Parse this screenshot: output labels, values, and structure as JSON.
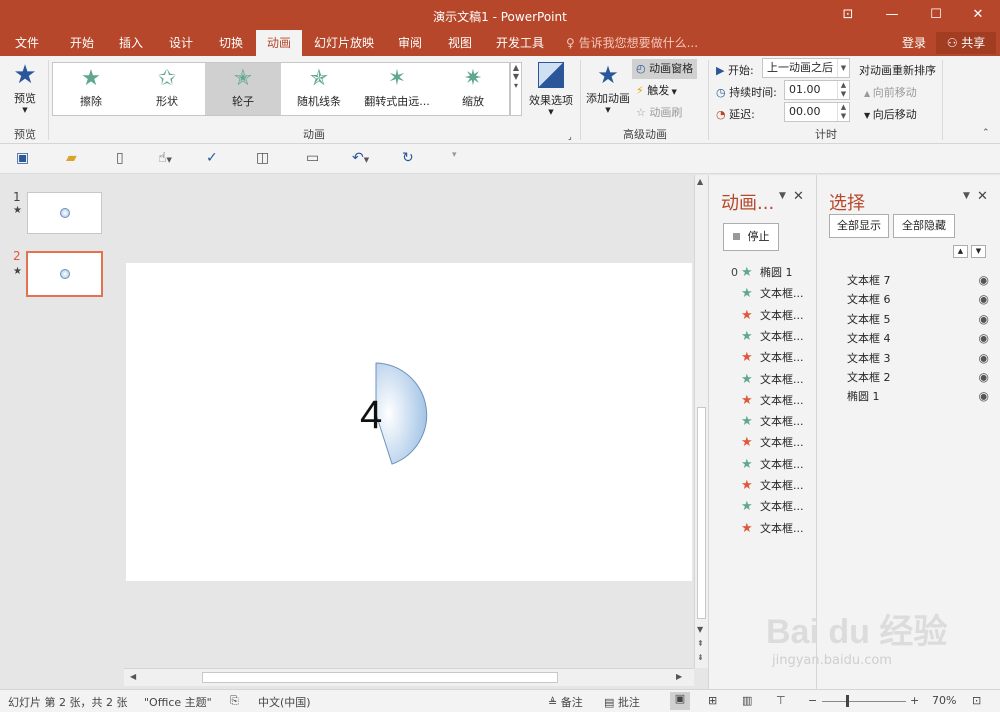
{
  "window": {
    "title": "演示文稿1 - PowerPoint"
  },
  "tabs": [
    "文件",
    "开始",
    "插入",
    "设计",
    "切换",
    "动画",
    "幻灯片放映",
    "审阅",
    "视图",
    "开发工具"
  ],
  "active_tab": "动画",
  "tell_me": "告诉我您想要做什么...",
  "signin": "登录",
  "share": "共享",
  "ribbon": {
    "preview": {
      "label": "预览",
      "group": "预览"
    },
    "animations": {
      "items": [
        {
          "label": "擦除",
          "color": "#5fa88e"
        },
        {
          "label": "形状",
          "color": "#5fa88e"
        },
        {
          "label": "轮子",
          "color": "#5fa88e"
        },
        {
          "label": "随机线条",
          "color": "#5fa88e"
        },
        {
          "label": "翻转式由远...",
          "color": "#5fa88e"
        },
        {
          "label": "缩放",
          "color": "#5fa88e"
        }
      ],
      "selected_index": 2,
      "effect_options": "效果选项",
      "group": "动画"
    },
    "advanced": {
      "add_animation": "添加动画",
      "animation_pane": "动画窗格",
      "trigger": "触发",
      "painter": "动画刷",
      "group": "高级动画"
    },
    "timing": {
      "start_label": "开始:",
      "start_value": "上一动画之后",
      "duration_label": "持续时间:",
      "duration_value": "01.00",
      "delay_label": "延迟:",
      "delay_value": "00.00",
      "reorder_title": "对动画重新排序",
      "move_earlier": "向前移动",
      "move_later": "向后移动",
      "group": "计时"
    }
  },
  "slides": [
    {
      "number": "1"
    },
    {
      "number": "2"
    }
  ],
  "selected_slide": 2,
  "slide_content": {
    "text": "4"
  },
  "animation_pane": {
    "title": "动画...",
    "stop": "停止",
    "items": [
      {
        "index": "0",
        "name": "椭圆 1",
        "color": "#5fa88e"
      },
      {
        "index": "",
        "name": "文本框...",
        "color": "#5fa88e"
      },
      {
        "index": "",
        "name": "文本框...",
        "color": "#e0583a"
      },
      {
        "index": "",
        "name": "文本框...",
        "color": "#5fa88e"
      },
      {
        "index": "",
        "name": "文本框...",
        "color": "#e0583a"
      },
      {
        "index": "",
        "name": "文本框...",
        "color": "#5fa88e"
      },
      {
        "index": "",
        "name": "文本框...",
        "color": "#e0583a"
      },
      {
        "index": "",
        "name": "文本框...",
        "color": "#5fa88e"
      },
      {
        "index": "",
        "name": "文本框...",
        "color": "#e0583a"
      },
      {
        "index": "",
        "name": "文本框...",
        "color": "#5fa88e"
      },
      {
        "index": "",
        "name": "文本框...",
        "color": "#e0583a"
      },
      {
        "index": "",
        "name": "文本框...",
        "color": "#5fa88e"
      },
      {
        "index": "",
        "name": "文本框...",
        "color": "#e0583a"
      }
    ]
  },
  "selection_pane": {
    "title": "选择",
    "show_all": "全部显示",
    "hide_all": "全部隐藏",
    "items": [
      "文本框 7",
      "文本框 6",
      "文本框 5",
      "文本框 4",
      "文本框 3",
      "文本框 2",
      "椭圆 1"
    ]
  },
  "status": {
    "slide_info": "幻灯片 第 2 张，共 2 张",
    "theme": "\"Office 主题\"",
    "language": "中文(中国)",
    "notes": "备注",
    "comments": "批注",
    "zoom": "70%"
  },
  "watermark": {
    "brand": "Bai du 经验",
    "url": "jingyan.baidu.com"
  },
  "colors": {
    "accent": "#b7472a",
    "green_star": "#5fa88e",
    "red_star": "#e0583a"
  }
}
